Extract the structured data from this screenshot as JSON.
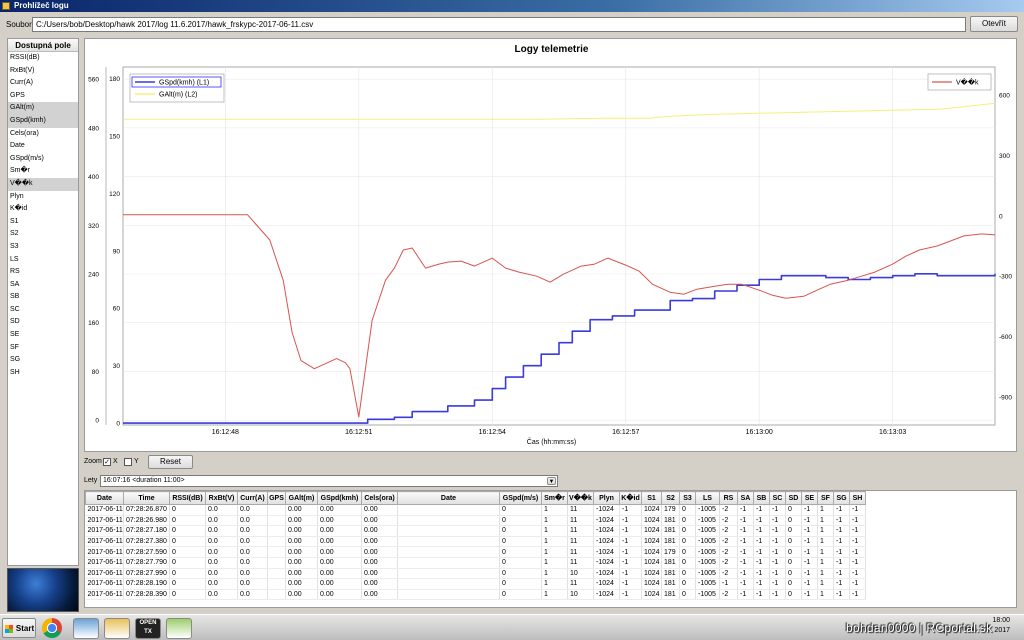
{
  "window": {
    "title": "Prohlížeč logu"
  },
  "file": {
    "label": "Soubor",
    "path": "C:/Users/bob/Desktop/hawk 2017/log 11.6.2017/hawk_frskypc-2017-06-11.csv",
    "open_label": "Otevřít"
  },
  "fields": {
    "header": "Dostupná pole",
    "items": [
      {
        "label": "RSSI(dB)",
        "selected": false
      },
      {
        "label": "RxBt(V)",
        "selected": false
      },
      {
        "label": "Curr(A)",
        "selected": false
      },
      {
        "label": "GPS",
        "selected": false
      },
      {
        "label": "GAlt(m)",
        "selected": true
      },
      {
        "label": "GSpd(kmh)",
        "selected": true
      },
      {
        "label": "Cels(ora)",
        "selected": false
      },
      {
        "label": "Date",
        "selected": false
      },
      {
        "label": "GSpd(m/s)",
        "selected": false
      },
      {
        "label": "Sm�r",
        "selected": false
      },
      {
        "label": "V��k",
        "selected": true
      },
      {
        "label": "Plyn",
        "selected": false
      },
      {
        "label": "K�id",
        "selected": false
      },
      {
        "label": "S1",
        "selected": false
      },
      {
        "label": "S2",
        "selected": false
      },
      {
        "label": "S3",
        "selected": false
      },
      {
        "label": "LS",
        "selected": false
      },
      {
        "label": "RS",
        "selected": false
      },
      {
        "label": "SA",
        "selected": false
      },
      {
        "label": "SB",
        "selected": false
      },
      {
        "label": "SC",
        "selected": false
      },
      {
        "label": "SD",
        "selected": false
      },
      {
        "label": "SE",
        "selected": false
      },
      {
        "label": "SF",
        "selected": false
      },
      {
        "label": "SG",
        "selected": false
      },
      {
        "label": "SH",
        "selected": false
      }
    ]
  },
  "chart_data": {
    "type": "line",
    "title": "Logy telemetrie",
    "xlabel": "Čas (hh:mm:ss)",
    "x_ticks": [
      "16:12:48",
      "16:12:51",
      "16:12:54",
      "16:12:57",
      "16:13:00",
      "16:13:03"
    ],
    "x_tick_seconds": [
      48,
      51,
      54,
      57,
      60,
      63
    ],
    "xlim": [
      45.7,
      65.3
    ],
    "axes": {
      "outer_left": {
        "ticks": [
          0,
          80,
          160,
          240,
          320,
          400,
          480,
          560
        ],
        "lim": [
          -8,
          580
        ]
      },
      "inner_left": {
        "ticks": [
          0,
          30,
          60,
          90,
          120,
          150,
          180
        ],
        "lim": [
          -1,
          186
        ]
      },
      "right": {
        "ticks": [
          -900,
          -600,
          -300,
          0,
          300,
          600
        ],
        "lim": [
          -1040,
          740
        ]
      }
    },
    "grid": true,
    "legends": [
      {
        "placement": "top-left",
        "entries": [
          "GSpd(kmh) (L1)",
          "GAlt(m) (L2)"
        ]
      },
      {
        "placement": "top-right",
        "entries": [
          "V��k"
        ]
      }
    ],
    "series": [
      {
        "name": "GSpd(kmh) (L1)",
        "axis": "inner_left",
        "color": "#3b3bd9",
        "step": true,
        "x": [
          45.7,
          48.0,
          50.0,
          50.9,
          51.2,
          51.8,
          52.2,
          52.9,
          53.0,
          53.6,
          54.0,
          54.3,
          54.7,
          55.1,
          55.5,
          55.8,
          56.2,
          56.7,
          57.2,
          58.0,
          58.5,
          59.0,
          59.5,
          60.0,
          60.5,
          61.0,
          61.5,
          62.0,
          62.5,
          63.0,
          63.5,
          64.0,
          64.5,
          65.3
        ],
        "y": [
          0,
          0,
          0,
          0,
          2,
          3,
          6,
          6,
          9,
          12,
          18,
          24,
          30,
          36,
          42,
          48,
          54,
          56,
          59,
          64,
          65,
          69,
          72,
          75,
          77,
          77,
          76,
          75,
          76,
          77,
          78,
          77,
          77,
          78
        ]
      },
      {
        "name": "GAlt(m) (L2)",
        "axis": "right",
        "color": "#f5f07a",
        "step": false,
        "x": [
          45.7,
          50.0,
          55.0,
          56.5,
          57.5,
          58.0,
          59.0,
          60.0,
          61.0,
          62.0,
          63.0,
          64.0,
          64.5,
          65.3
        ],
        "y": [
          480,
          480,
          480,
          485,
          485,
          495,
          505,
          510,
          515,
          520,
          525,
          530,
          540,
          560
        ]
      },
      {
        "name": "V��k",
        "axis": "right",
        "color": "#d9534f",
        "step": false,
        "x": [
          45.7,
          46.5,
          47.5,
          48.5,
          49.0,
          49.3,
          49.5,
          49.7,
          50.0,
          50.2,
          50.5,
          50.7,
          50.8,
          51.0,
          51.3,
          51.6,
          51.8,
          52.0,
          52.2,
          52.5,
          52.8,
          53.0,
          53.3,
          53.6,
          54.0,
          54.3,
          54.6,
          55.0,
          55.3,
          55.6,
          56.0,
          56.3,
          56.6,
          57.0,
          57.3,
          57.6,
          58.0,
          58.3,
          58.6,
          59.0,
          59.3,
          59.6,
          60.0,
          60.3,
          60.6,
          61.0,
          61.3,
          61.6,
          62.0,
          62.3,
          62.6,
          63.0,
          63.3,
          63.6,
          64.0,
          64.3,
          64.6,
          65.0,
          65.3
        ],
        "y": [
          5,
          5,
          5,
          5,
          -120,
          -320,
          -580,
          -720,
          -760,
          -740,
          -710,
          -730,
          -760,
          -1000,
          -520,
          -320,
          -260,
          -170,
          -160,
          -260,
          -240,
          -230,
          -225,
          -250,
          -210,
          -260,
          -280,
          -300,
          -330,
          -290,
          -250,
          -240,
          -210,
          -245,
          -275,
          -340,
          -380,
          -390,
          -365,
          -350,
          -340,
          -340,
          -370,
          -395,
          -410,
          -400,
          -370,
          -340,
          -320,
          -300,
          -280,
          -240,
          -200,
          -170,
          -150,
          -125,
          -100,
          -90,
          -95
        ]
      }
    ]
  },
  "zoom": {
    "label": "Zoom",
    "x_label": "X",
    "x_checked": true,
    "y_label": "Y",
    "y_checked": false,
    "reset_label": "Reset"
  },
  "lety": {
    "label": "Lety",
    "value": "16:07:16 <duration 11:00>"
  },
  "table": {
    "columns": [
      "Date",
      "Time",
      "RSSI(dB)",
      "RxBt(V)",
      "Curr(A)",
      "GPS",
      "GAlt(m)",
      "GSpd(kmh)",
      "Cels(ora)",
      "Date",
      "GSpd(m/s)",
      "Sm�r",
      "V��k",
      "Plyn",
      "K�id",
      "S1",
      "S2",
      "S3",
      "LS",
      "RS",
      "SA",
      "SB",
      "SC",
      "SD",
      "SE",
      "SF",
      "SG",
      "SH"
    ],
    "rows": [
      [
        "2017-06-11",
        "07:28:26.870",
        "0",
        "0.0",
        "0.0",
        "",
        "0.00",
        "0.00",
        "0.00",
        "",
        "0",
        "1",
        "11",
        "-1024",
        "-1",
        "1024",
        "179",
        "0",
        "-1005",
        "-2",
        "-1",
        "-1",
        "-1",
        "0",
        "-1",
        "1",
        "-1",
        "-1"
      ],
      [
        "2017-06-11",
        "07:28:26.980",
        "0",
        "0.0",
        "0.0",
        "",
        "0.00",
        "0.00",
        "0.00",
        "",
        "0",
        "1",
        "11",
        "-1024",
        "-1",
        "1024",
        "181",
        "0",
        "-1005",
        "-2",
        "-1",
        "-1",
        "-1",
        "0",
        "-1",
        "1",
        "-1",
        "-1"
      ],
      [
        "2017-06-11",
        "07:28:27.180",
        "0",
        "0.0",
        "0.0",
        "",
        "0.00",
        "0.00",
        "0.00",
        "",
        "0",
        "1",
        "11",
        "-1024",
        "-1",
        "1024",
        "181",
        "0",
        "-1005",
        "-2",
        "-1",
        "-1",
        "-1",
        "0",
        "-1",
        "1",
        "-1",
        "-1"
      ],
      [
        "2017-06-11",
        "07:28:27.380",
        "0",
        "0.0",
        "0.0",
        "",
        "0.00",
        "0.00",
        "0.00",
        "",
        "0",
        "1",
        "11",
        "-1024",
        "-1",
        "1024",
        "181",
        "0",
        "-1005",
        "-2",
        "-1",
        "-1",
        "-1",
        "0",
        "-1",
        "1",
        "-1",
        "-1"
      ],
      [
        "2017-06-11",
        "07:28:27.590",
        "0",
        "0.0",
        "0.0",
        "",
        "0.00",
        "0.00",
        "0.00",
        "",
        "0",
        "1",
        "11",
        "-1024",
        "-1",
        "1024",
        "179",
        "0",
        "-1005",
        "-2",
        "-1",
        "-1",
        "-1",
        "0",
        "-1",
        "1",
        "-1",
        "-1"
      ],
      [
        "2017-06-11",
        "07:28:27.790",
        "0",
        "0.0",
        "0.0",
        "",
        "0.00",
        "0.00",
        "0.00",
        "",
        "0",
        "1",
        "11",
        "-1024",
        "-1",
        "1024",
        "181",
        "0",
        "-1005",
        "-2",
        "-1",
        "-1",
        "-1",
        "0",
        "-1",
        "1",
        "-1",
        "-1"
      ],
      [
        "2017-06-11",
        "07:28:27.990",
        "0",
        "0.0",
        "0.0",
        "",
        "0.00",
        "0.00",
        "0.00",
        "",
        "0",
        "1",
        "10",
        "-1024",
        "-1",
        "1024",
        "181",
        "0",
        "-1005",
        "-2",
        "-1",
        "-1",
        "-1",
        "0",
        "-1",
        "1",
        "-1",
        "-1"
      ],
      [
        "2017-06-11",
        "07:28:28.190",
        "0",
        "0.0",
        "0.0",
        "",
        "0.00",
        "0.00",
        "0.00",
        "",
        "0",
        "1",
        "11",
        "-1024",
        "-1",
        "1024",
        "181",
        "0",
        "-1005",
        "-1",
        "-1",
        "-1",
        "-1",
        "0",
        "-1",
        "1",
        "-1",
        "-1"
      ],
      [
        "2017-06-11",
        "07:28:28.390",
        "0",
        "0.0",
        "0.0",
        "",
        "0.00",
        "0.00",
        "0.00",
        "",
        "0",
        "1",
        "10",
        "-1024",
        "-1",
        "1024",
        "181",
        "0",
        "-1005",
        "-2",
        "-1",
        "-1",
        "-1",
        "0",
        "-1",
        "1",
        "-1",
        "-1"
      ]
    ]
  },
  "taskbar": {
    "start_label": "Start",
    "apps": [
      {
        "icon": "chrome-icon",
        "color": "#db4437"
      },
      {
        "icon": "calculator-icon",
        "color": "#6aa3d8"
      },
      {
        "icon": "file-explorer-icon",
        "color": "#e8c15a"
      },
      {
        "icon": "opentx-icon",
        "color": "#222222",
        "label": "OPEN TX"
      },
      {
        "icon": "paint-icon",
        "color": "#9ccf6a"
      }
    ],
    "time": "18:00",
    "date": "2017"
  },
  "watermark": "bohdan0000 | RCportal.sk"
}
